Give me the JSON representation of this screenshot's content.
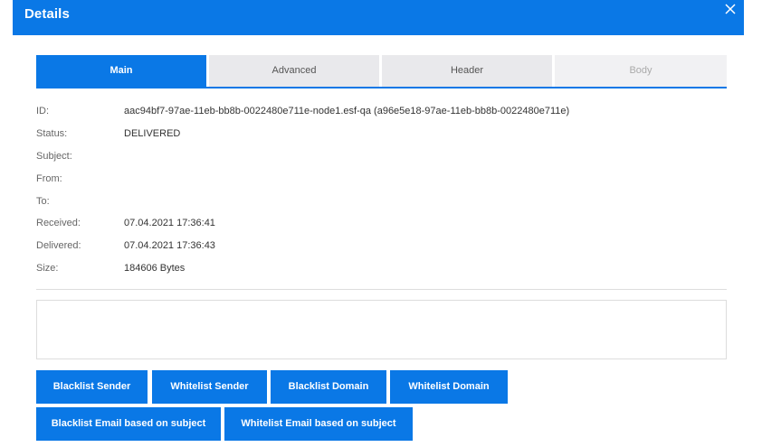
{
  "dialog": {
    "title": "Details"
  },
  "tabs": [
    {
      "label": "Main",
      "state": "active"
    },
    {
      "label": "Advanced",
      "state": "normal"
    },
    {
      "label": "Header",
      "state": "normal"
    },
    {
      "label": "Body",
      "state": "disabled"
    }
  ],
  "fields": {
    "id": {
      "label": "ID:",
      "value": "aac94bf7-97ae-11eb-bb8b-0022480e711e-node1.esf-qa (a96e5e18-97ae-11eb-bb8b-0022480e711e)"
    },
    "status": {
      "label": "Status:",
      "value": "DELIVERED"
    },
    "subject": {
      "label": "Subject:",
      "value": ""
    },
    "from": {
      "label": "From:",
      "value": ""
    },
    "to": {
      "label": "To:",
      "value": ""
    },
    "received": {
      "label": "Received:",
      "value": "07.04.2021 17:36:41"
    },
    "delivered": {
      "label": "Delivered:",
      "value": "07.04.2021 17:36:43"
    },
    "size": {
      "label": "Size:",
      "value": "184606 Bytes"
    }
  },
  "actions": {
    "blacklist_sender": "Blacklist Sender",
    "whitelist_sender": "Whitelist Sender",
    "blacklist_domain": "Blacklist Domain",
    "whitelist_domain": "Whitelist Domain",
    "blacklist_subject": "Blacklist Email based on subject",
    "whitelist_subject": "Whitelist Email based on subject"
  },
  "colors": {
    "primary": "#0a78e6",
    "tab_inactive": "#e9e9ec",
    "tab_disabled": "#f1f1f3"
  },
  "icons": {
    "close": "close-icon"
  }
}
